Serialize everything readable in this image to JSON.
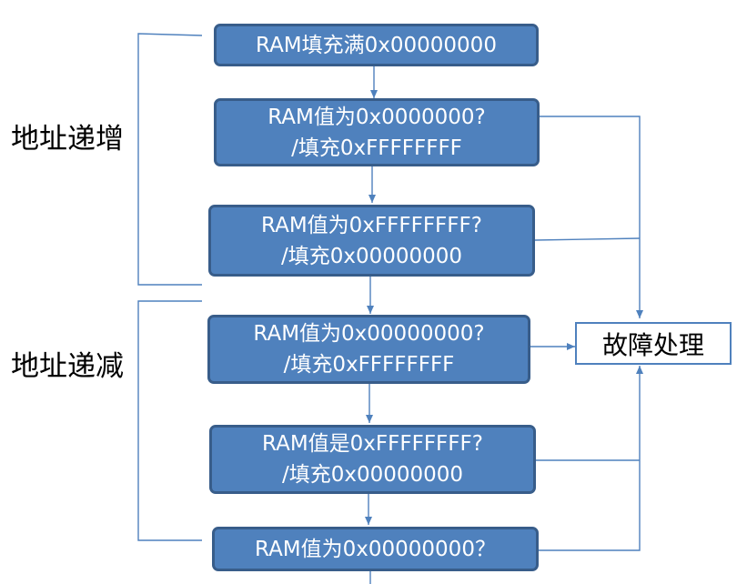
{
  "sections": {
    "increment_label": "地址递增",
    "decrement_label": "地址递减"
  },
  "steps": [
    {
      "line1": "RAM填充满0x00000000",
      "line2": ""
    },
    {
      "line1": "RAM值为0x0000000?",
      "line2": "/填充0xFFFFFFFF"
    },
    {
      "line1": "RAM值为0xFFFFFFFF?",
      "line2": "/填充0x00000000"
    },
    {
      "line1": "RAM值为0x00000000?",
      "line2": "/填充0xFFFFFFFF"
    },
    {
      "line1": "RAM值是0xFFFFFFFF?",
      "line2": "/填充0x00000000"
    },
    {
      "line1": "RAM值为0x00000000？",
      "line2": ""
    }
  ],
  "fault": {
    "label": "故障处理"
  },
  "colors": {
    "box_fill": "#4f81bd",
    "box_border": "#385d8a",
    "line": "#4f81bd"
  }
}
